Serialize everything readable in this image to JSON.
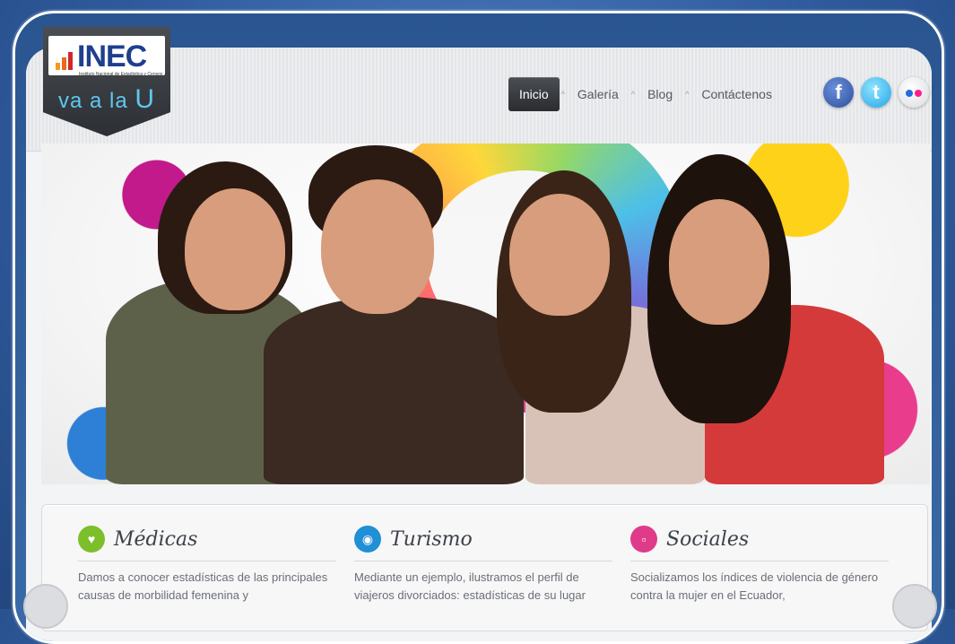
{
  "logo": {
    "brand": "INEC",
    "subtitle": "Instituto Nacional de Estadística y Censos",
    "tagline_prefix": "va a la",
    "tagline_letter": "U"
  },
  "nav": {
    "items": [
      "Inicio",
      "Galería",
      "Blog",
      "Contáctenos"
    ],
    "active": "Inicio"
  },
  "social": [
    {
      "icon": "facebook-icon",
      "glyph": "f"
    },
    {
      "icon": "twitter-icon",
      "glyph": "t"
    },
    {
      "icon": "flickr-icon",
      "glyph": ""
    }
  ],
  "columns": [
    {
      "title": "Médicas",
      "icon": "heart-icon",
      "color": "#7cbf2a",
      "text": "Damos a conocer estadísticas de las principales causas de morbilidad femenina y"
    },
    {
      "title": "Turismo",
      "icon": "camera-icon",
      "color": "#1f8fd6",
      "text": "Mediante un ejemplo, ilustramos el perfil de viajeros divorciados: estadísticas de su lugar"
    },
    {
      "title": "Sociales",
      "icon": "chat-icon",
      "color": "#e03a8a",
      "text": "Socializamos los índices de violencia de género contra la mujer en el Ecuador,"
    }
  ]
}
